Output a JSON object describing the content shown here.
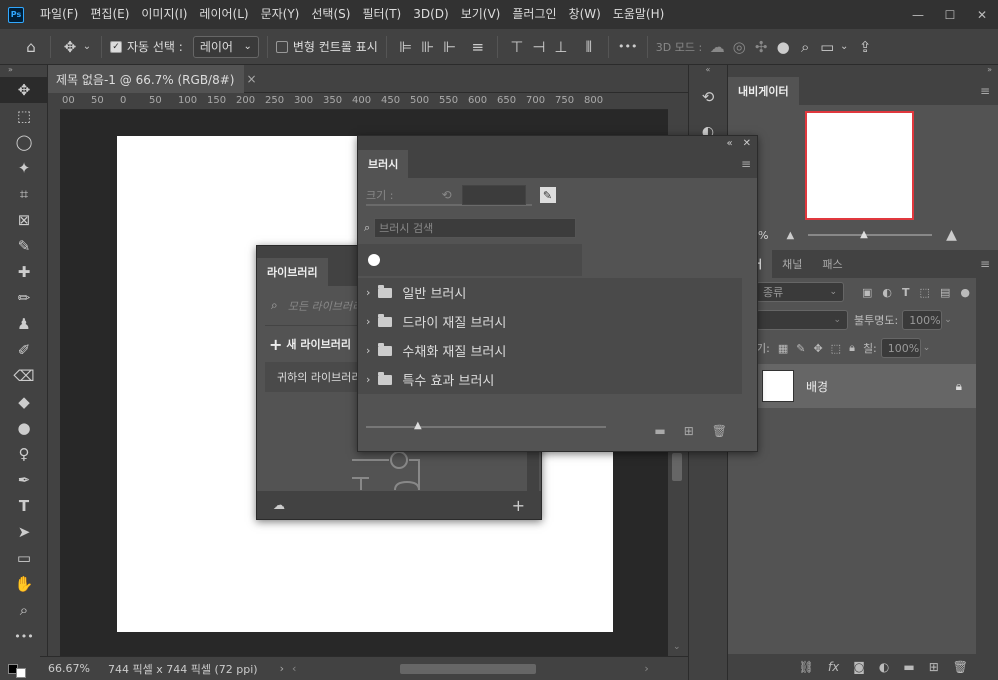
{
  "app": {
    "logo": "Ps"
  },
  "menu": [
    "파일(F)",
    "편집(E)",
    "이미지(I)",
    "레이어(L)",
    "문자(Y)",
    "선택(S)",
    "필터(T)",
    "3D(D)",
    "보기(V)",
    "플러그인",
    "창(W)",
    "도움말(H)"
  ],
  "window_controls": {
    "minimize": "—",
    "maximize": "☐",
    "close": "✕"
  },
  "options_bar": {
    "auto_select_label": "자동 선택 :",
    "auto_select_value": "레이어",
    "transform_controls_label": "변형 컨트롤 표시",
    "more": "•••",
    "mode_3d": "3D 모드 :"
  },
  "document": {
    "tab_title": "제목 없음-1 @ 66.7% (RGB/8#)",
    "close": "×",
    "ruler_marks": [
      "00",
      "50",
      "0",
      "50",
      "100",
      "150",
      "200",
      "250",
      "300",
      "350",
      "400",
      "450",
      "500",
      "550",
      "600",
      "650",
      "700",
      "750",
      "800"
    ],
    "zoom": "66.67%",
    "size": "744 픽셀 x 744 픽셀 (72 ppi)"
  },
  "navigator": {
    "tab": "내비게이터",
    "zoom": "%"
  },
  "layers_panel": {
    "tabs": [
      "어",
      "채널",
      "패스"
    ],
    "filter_label": "종류",
    "blend_mode": "",
    "opacity_label": "불투명도:",
    "opacity_value": "100%",
    "lock_label": "기:",
    "fill_label": "칠:",
    "fill_value": "100%",
    "layers": [
      {
        "name": "배경"
      }
    ]
  },
  "brush_panel": {
    "tab": "브러시",
    "size_label": "크기 :",
    "search_placeholder": "브러시 검색",
    "folders": [
      "일반 브러시",
      "드라이 재질 브러시",
      "수채화 재질 브러시",
      "특수 효과 브러시"
    ]
  },
  "library_panel": {
    "tab": "라이브러리",
    "search_placeholder": "모든 라이브러리",
    "new_library": "새 라이브러리",
    "your_library": "귀하의 라이브러리"
  }
}
